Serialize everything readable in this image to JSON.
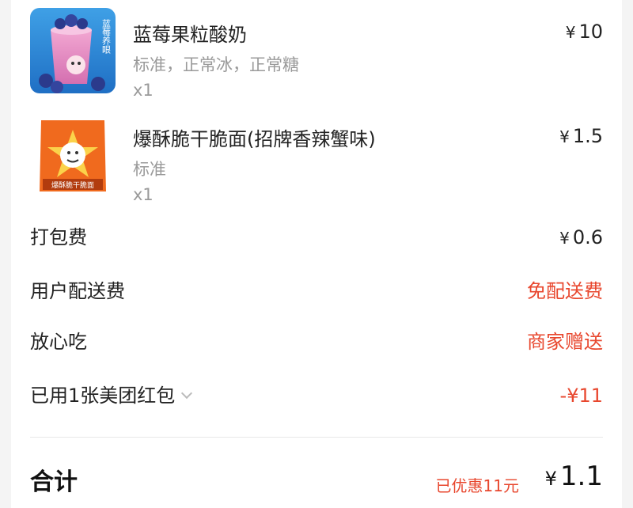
{
  "items": [
    {
      "name": "蓝莓果粒酸奶",
      "spec": "标准，正常冰，正常糖",
      "qty": "x1",
      "price": "10",
      "image_text": "蓝莓养眼"
    },
    {
      "name": "爆酥脆干脆面(招牌香辣蟹味)",
      "spec": "标准",
      "qty": "x1",
      "price": "1.5",
      "image_text": "爆酥脆干脆面"
    }
  ],
  "currency": "¥",
  "fees": {
    "packing_label": "打包费",
    "packing_value": "0.6",
    "delivery_label": "用户配送费",
    "delivery_value": "免配送费",
    "assurance_label": "放心吃",
    "assurance_value": "商家赠送",
    "coupon_label": "已用1张美团红包",
    "coupon_value": "-¥11"
  },
  "total": {
    "label": "合计",
    "saved": "已优惠11元",
    "value": "1.1"
  },
  "colors": {
    "accent": "#e8472e"
  },
  "icons": {
    "coupon_expand": "chevron-down-icon"
  }
}
